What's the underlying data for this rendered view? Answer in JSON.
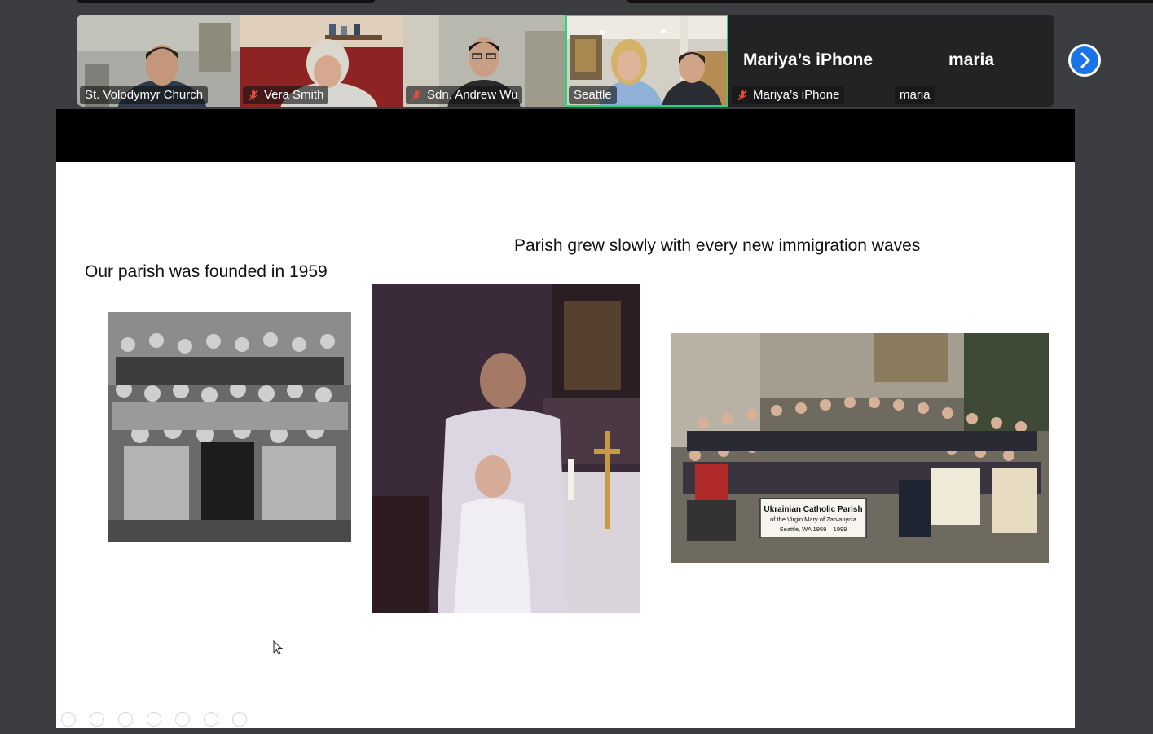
{
  "participants": [
    {
      "name": "St. Volodymyr Church",
      "muted": false
    },
    {
      "name": "Vera Smith",
      "muted": true
    },
    {
      "name": "Sdn. Andrew Wu",
      "muted": true
    },
    {
      "name": "Seattle",
      "muted": false,
      "active_speaker": true
    },
    {
      "name": "Mariya’s iPhone",
      "title": "Mariya’s iPhone",
      "muted": true,
      "video": false
    },
    {
      "name": "maria",
      "title": "maria",
      "muted": false,
      "video": false
    }
  ],
  "slide": {
    "heading_left": "Our parish was founded in 1959",
    "heading_right": "Parish grew slowly with every new immigration waves",
    "banner_line1": "Ukrainian Catholic Parish",
    "banner_line2": "of the Virgin Mary of Zarvanycia",
    "banner_line3": "Seattle, WA      1959 – 1999"
  },
  "icons": {
    "next_page": "chevron-right-icon",
    "mic_off": "mic-off-icon",
    "cursor": "mouse-pointer-icon",
    "slide_controls": [
      "previous-slide-icon",
      "next-slide-icon",
      "pen-icon",
      "slides-overview-icon",
      "zoom-icon",
      "camera-icon",
      "more-icon"
    ]
  },
  "colors": {
    "active_speaker_border": "#29d67a",
    "next_button": "#1a73e8",
    "app_background": "#3c3d40",
    "mic_off": "#e8493f"
  }
}
